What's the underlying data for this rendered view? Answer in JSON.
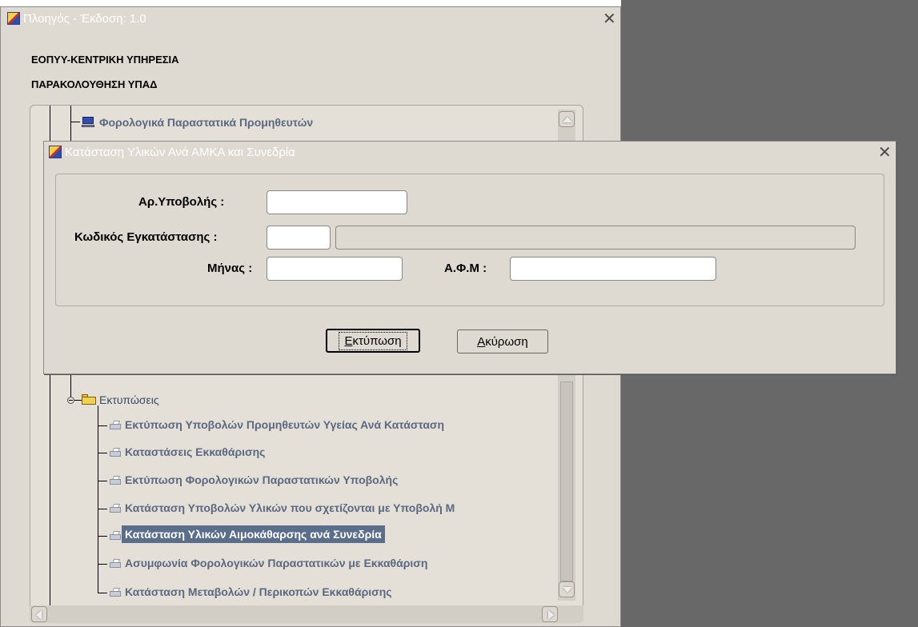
{
  "main_window": {
    "title": "Πλοηγός - Έκδοση: 1.0",
    "org_label": "ΕΟΠΥΥ-ΚΕΝΤΡΙΚΗ ΥΠΗΡΕΣΙΑ",
    "module_label": "ΠΑΡΑΚΟΛΟΥΘΗΣΗ ΥΠΑΔ"
  },
  "tree": {
    "top_item": "Φορολογικά Παραστατικά Προμηθευτών",
    "folder": "Εκτυπώσεις",
    "items": [
      "Εκτύπωση Υποβολών Προμηθευτών Υγείας Ανά Κατάσταση",
      "Καταστάσεις Εκκαθάρισης",
      "Εκτύπωση Φορολογικών Παραστατικών Υποβολής",
      "Κατάσταση Υποβολών Υλικών που σχετίζονται με Υποβολή Μ",
      "Κατάσταση Υλικών Αιμοκάθαρσης ανά Συνεδρία",
      "Ασυμφωνία Φορολογικών Παραστατικών με Εκκαθάριση",
      "Κατάσταση Μεταβολών / Περικοπών Εκκαθάρισης"
    ],
    "selected_index": 4
  },
  "dialog": {
    "title": "Κατάσταση Υλικών Ανά ΑΜΚΑ και Συνεδρία",
    "fields": {
      "submission_no_label": "Αρ.Υποβολής :",
      "submission_no_value": "",
      "facility_code_label": "Κωδικός Εγκατάστασης :",
      "facility_code_value": "",
      "facility_name_value": "",
      "month_label": "Μήνας :",
      "month_value": "",
      "afm_label": "Α.Φ.Μ :",
      "afm_value": ""
    },
    "buttons": {
      "print_mnemonic": "Ε",
      "print_rest": "κτύπωση",
      "cancel_mnemonic": "Α",
      "cancel_rest": "κύρωση"
    }
  },
  "colors": {
    "desktop": "#686868",
    "window": "#dedad2",
    "selected_node": "#5a6e8c",
    "node_text": "#5a6880"
  }
}
